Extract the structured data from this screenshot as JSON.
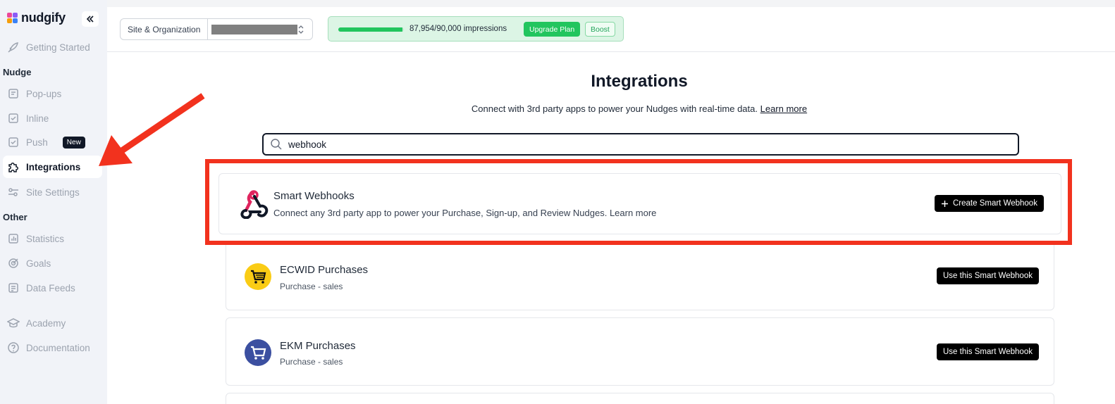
{
  "brand": {
    "name": "nudgify"
  },
  "sidebar": {
    "getting_started": "Getting Started",
    "section_nudge": "Nudge",
    "popups": "Pop-ups",
    "inline": "Inline",
    "push": "Push",
    "push_badge": "New",
    "integrations": "Integrations",
    "site_settings": "Site Settings",
    "section_other": "Other",
    "statistics": "Statistics",
    "goals": "Goals",
    "data_feeds": "Data Feeds",
    "academy": "Academy",
    "documentation": "Documentation"
  },
  "topbar": {
    "site_label": "Site & Organization",
    "usage_text": "87,954/90,000 impressions",
    "usage_fraction": 0.977,
    "upgrade_label": "Upgrade Plan",
    "boost_label": "Boost"
  },
  "main": {
    "title": "Integrations",
    "subtitle": "Connect with 3rd party apps to power your Nudges with real-time data.",
    "learn_more": "Learn more",
    "search_value": "webhook"
  },
  "cards": [
    {
      "title": "Smart Webhooks",
      "description": "Connect any 3rd party app to power your Purchase, Sign-up, and Review Nudges. Learn more",
      "button": "Create Smart Webhook",
      "icon": "webhook-icon"
    },
    {
      "title": "ECWID Purchases",
      "subtitle": "Purchase - sales",
      "button": "Use this Smart Webhook",
      "icon": "ecwid-cart-icon"
    },
    {
      "title": "EKM Purchases",
      "subtitle": "Purchase - sales",
      "button": "Use this Smart Webhook",
      "icon": "ekm-cart-icon"
    }
  ],
  "colors": {
    "accent_green": "#22c55e",
    "highlight_red": "#f2321e",
    "sidebar_bg": "#f1f3f8"
  }
}
